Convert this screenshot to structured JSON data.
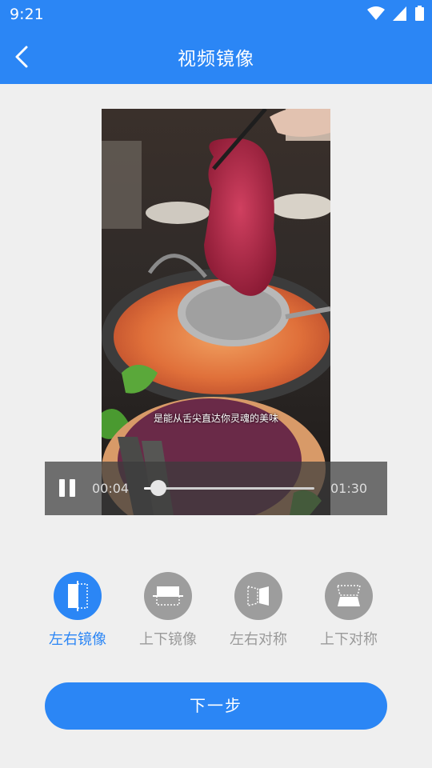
{
  "status_bar": {
    "time": "9:21"
  },
  "header": {
    "title": "视频镜像"
  },
  "video": {
    "subtitle": "是能从舌尖直达你灵魂的美味",
    "current_time": "00:04",
    "duration": "01:30",
    "progress": 0.044
  },
  "options": [
    {
      "label": "左右镜像",
      "icon": "mirror-horizontal-icon",
      "selected": true
    },
    {
      "label": "上下镜像",
      "icon": "mirror-vertical-icon",
      "selected": false
    },
    {
      "label": "左右对称",
      "icon": "symmetry-horizontal-icon",
      "selected": false
    },
    {
      "label": "上下对称",
      "icon": "symmetry-vertical-icon",
      "selected": false
    }
  ],
  "next_button": {
    "label": "下一步"
  },
  "colors": {
    "accent": "#2b86f5",
    "inactive": "#9d9d9d"
  }
}
